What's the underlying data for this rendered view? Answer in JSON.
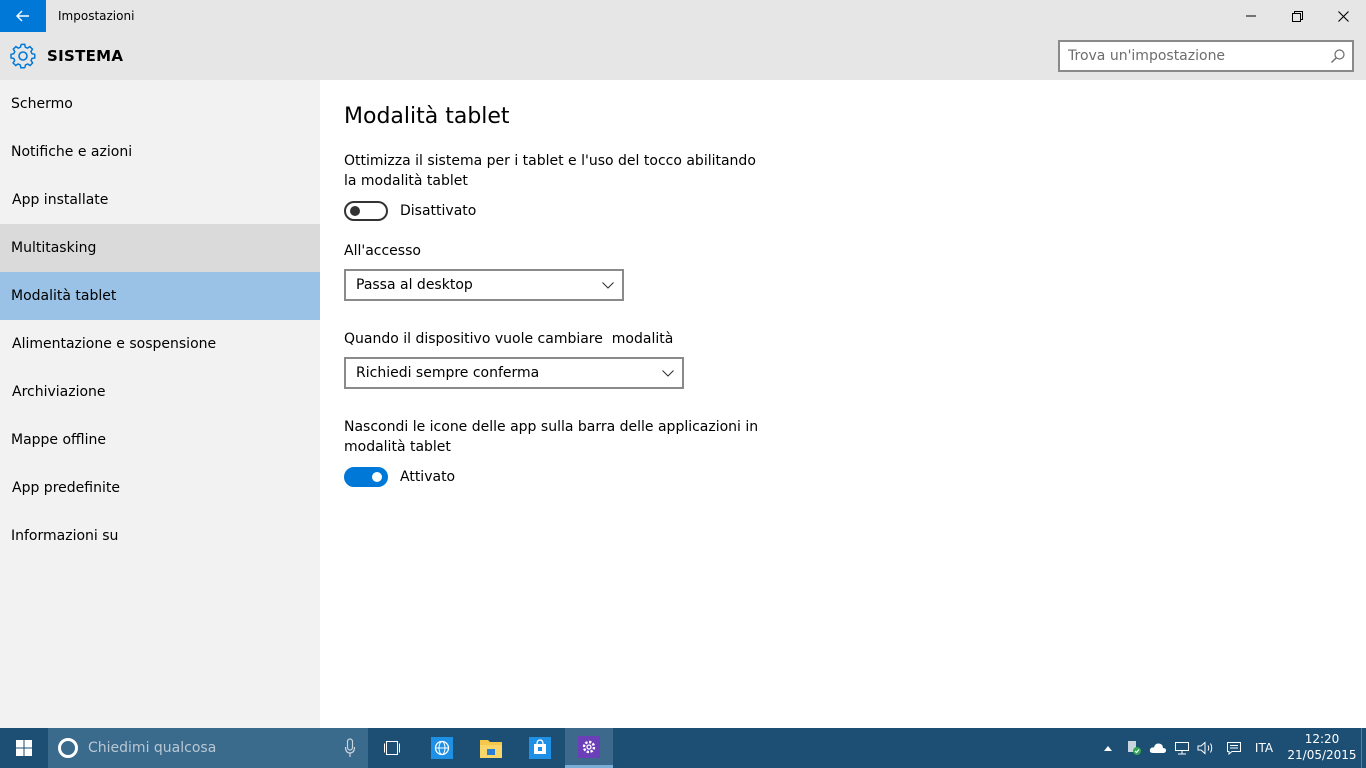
{
  "window": {
    "title": "Impostazioni"
  },
  "header": {
    "section_title": "SISTEMA",
    "search_placeholder": "Trova un'impostazione"
  },
  "sidebar": {
    "items": [
      {
        "label": "Schermo",
        "state": "normal"
      },
      {
        "label": "Notifiche e azioni",
        "state": "normal"
      },
      {
        "label": "App installate",
        "state": "normal"
      },
      {
        "label": "Multitasking",
        "state": "hover"
      },
      {
        "label": "Modalità tablet",
        "state": "selected"
      },
      {
        "label": "Alimentazione e sospensione",
        "state": "normal"
      },
      {
        "label": "Archiviazione",
        "state": "normal"
      },
      {
        "label": "Mappe offline",
        "state": "normal"
      },
      {
        "label": "App predefinite",
        "state": "normal"
      },
      {
        "label": "Informazioni su",
        "state": "normal"
      }
    ]
  },
  "main": {
    "title": "Modalità tablet",
    "tablet_mode": {
      "description": "Ottimizza il sistema per i tablet e l'uso del tocco abilitando la modalità tablet",
      "toggle_state": "Disattivato",
      "enabled": false
    },
    "sign_in": {
      "label": "All'accesso",
      "selected": "Passa al desktop"
    },
    "switch_mode": {
      "label": "Quando il dispositivo vuole cambiare  modalità",
      "selected": "Richiedi sempre conferma"
    },
    "hide_icons": {
      "description": "Nascondi le icone delle app sulla barra delle applicazioni in modalità tablet",
      "toggle_state": "Attivato",
      "enabled": true
    }
  },
  "taskbar": {
    "search_placeholder": "Chiedimi qualcosa",
    "apps": [
      "task-view",
      "edge",
      "file-explorer",
      "store",
      "settings"
    ],
    "active_app": "settings",
    "language": "ITA",
    "time": "12:20",
    "date": "21/05/2015"
  },
  "colors": {
    "accent": "#0078d7",
    "selected_item": "#99c2e6",
    "hover_item": "#dadada",
    "sidebar_bg": "#f2f2f2",
    "taskbar_bg": "#1d4e73"
  }
}
